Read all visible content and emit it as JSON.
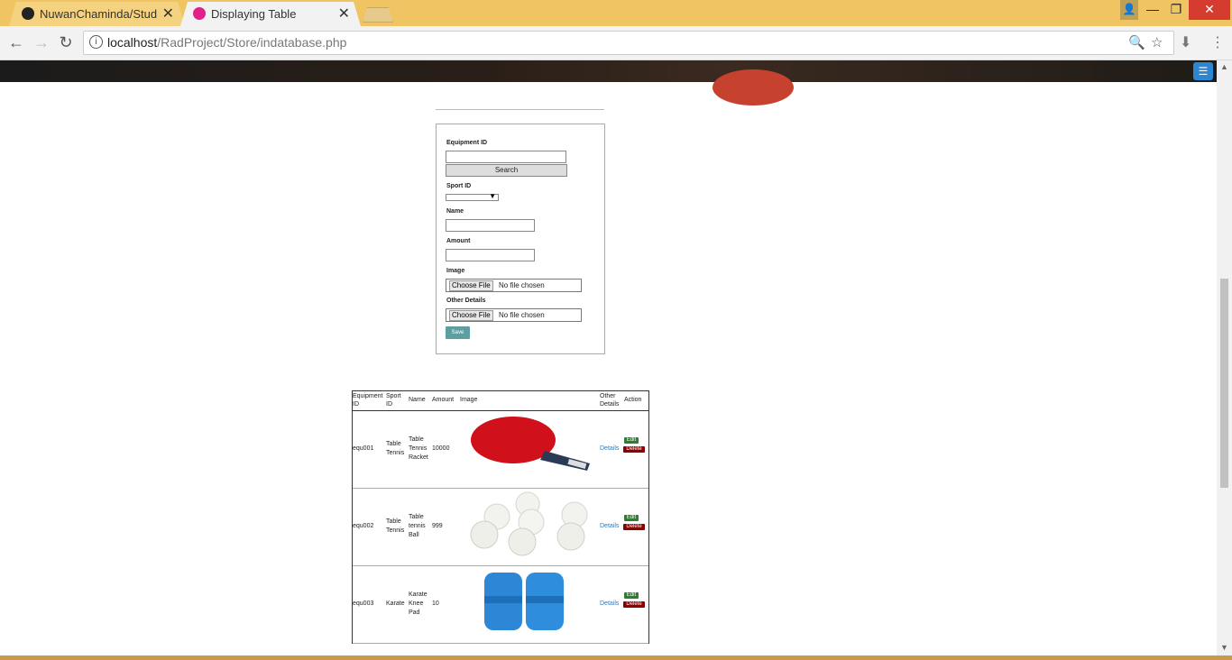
{
  "tabs": [
    {
      "title": "NuwanChaminda/Studen",
      "active": false
    },
    {
      "title": "Displaying Table",
      "active": true
    }
  ],
  "address": {
    "host": "localhost",
    "path": "/RadProject/Store/indatabase.php"
  },
  "form": {
    "equipment_id_label": "Equipment ID",
    "search_label": "Search",
    "sport_id_label": "Sport ID",
    "name_label": "Name",
    "amount_label": "Amount",
    "image_label": "Image",
    "other_details_label": "Other Details",
    "choose_file_label": "Choose File",
    "no_file_label": "No file chosen",
    "save_label": "Save"
  },
  "table": {
    "headers": [
      "Equipment ID",
      "Sport ID",
      "Name",
      "Amount",
      "Image",
      "Other Details",
      "Action"
    ],
    "details_label": "Details",
    "edit_label": "Edit",
    "delete_label": "Delete",
    "rows": [
      {
        "id": "equ001",
        "sport": "Table Tennis",
        "name": "Table Tennis Racket",
        "amount": "10000",
        "image": "table-tennis-racket"
      },
      {
        "id": "equ002",
        "sport": "Table Tennis",
        "name": "Table tennis Ball",
        "amount": "999",
        "image": "table-tennis-balls"
      },
      {
        "id": "equ003",
        "sport": "Karate",
        "name": "Karate Knee Pad",
        "amount": "10",
        "image": "karate-knee-pads"
      }
    ]
  }
}
